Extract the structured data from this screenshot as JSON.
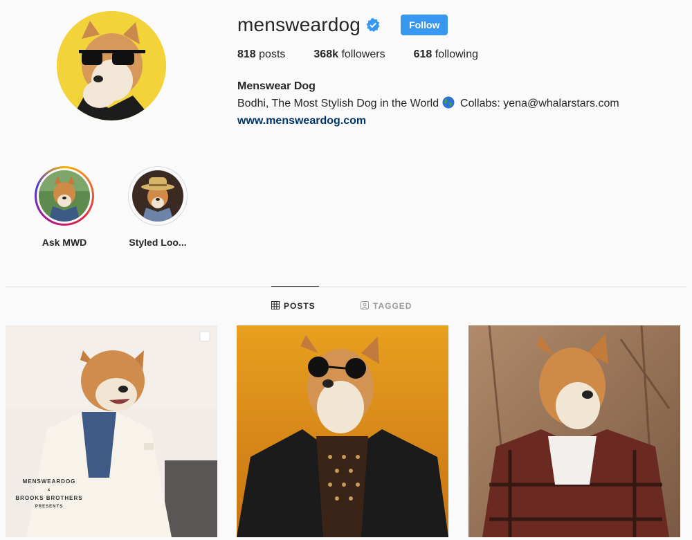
{
  "profile": {
    "username": "mensweardog",
    "follow_label": "Follow",
    "posts_count": "818",
    "posts_label": "posts",
    "followers_count": "368k",
    "followers_label": "followers",
    "following_count": "618",
    "following_label": "following",
    "full_name": "Menswear Dog",
    "bio_text": "Bodhi, The Most Stylish Dog in the World",
    "bio_collab": "Collabs: yena@whalarstars.com",
    "website": "www.mensweardog.com",
    "verified_icon": "verified-badge-icon",
    "globe_icon": "globe-icon"
  },
  "highlights": [
    {
      "label": "Ask MWD",
      "ring": "colored"
    },
    {
      "label": "Styled Loo...",
      "ring": "plain"
    }
  ],
  "tabs": [
    {
      "label": "POSTS",
      "icon": "grid-icon",
      "active": true
    },
    {
      "label": "TAGGED",
      "icon": "tag-icon",
      "active": false
    }
  ],
  "posts": [
    {
      "caption_line1": "MENSWEARDOG",
      "caption_x": "x",
      "caption_line2": "BROOKS BROTHERS",
      "caption_line3": "PRESENTS",
      "icon": "multiple-posts-icon"
    },
    {},
    {}
  ],
  "colors": {
    "accent": "#3897f0",
    "link": "#003569",
    "background": "#fafafa",
    "avatar_bg": "#f2d33a"
  }
}
